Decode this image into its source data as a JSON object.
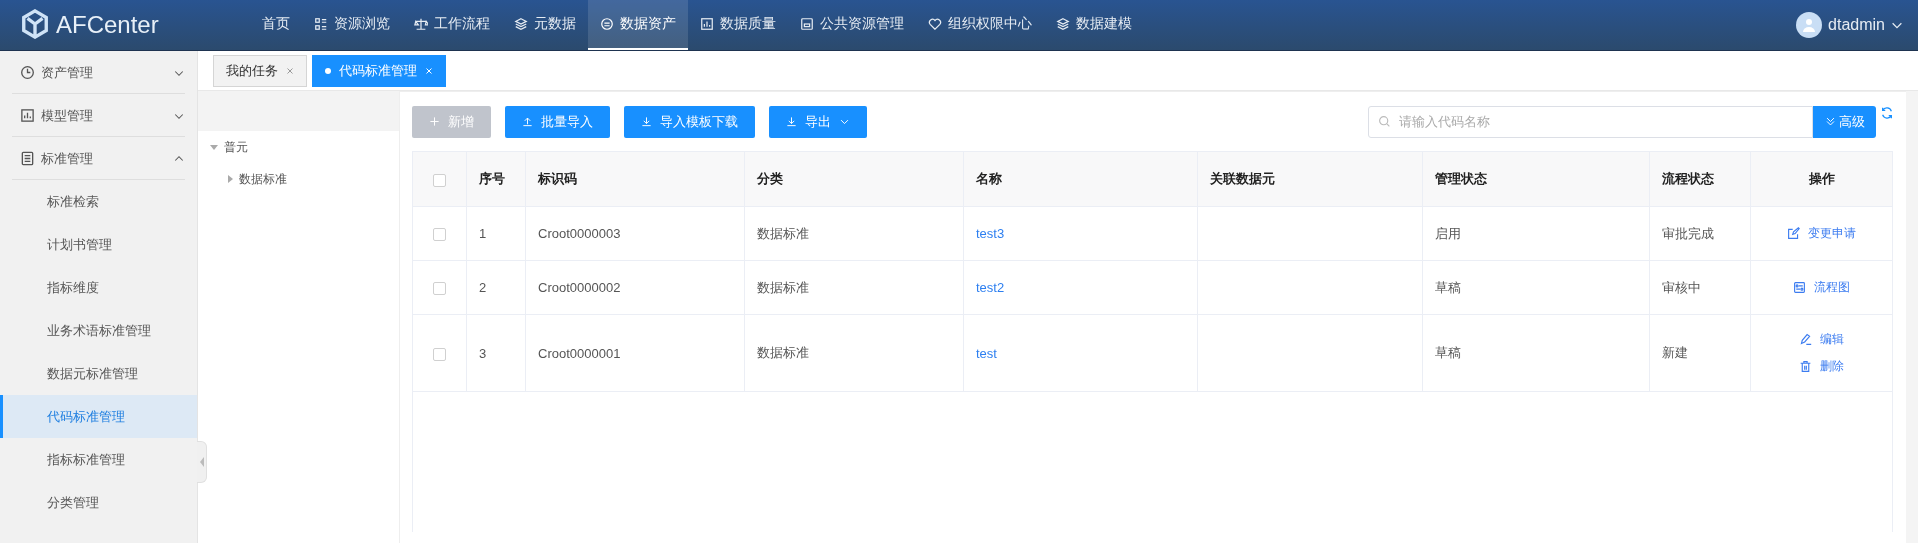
{
  "header": {
    "logo": "AFCenter",
    "nav": [
      {
        "label": "首页",
        "selected": false
      },
      {
        "label": "资源浏览",
        "selected": false
      },
      {
        "label": "工作流程",
        "selected": false
      },
      {
        "label": "元数据",
        "selected": false
      },
      {
        "label": "数据资产",
        "selected": true
      },
      {
        "label": "数据质量",
        "selected": false
      },
      {
        "label": "公共资源管理",
        "selected": false
      },
      {
        "label": "组织权限中心",
        "selected": false
      },
      {
        "label": "数据建模",
        "selected": false
      }
    ],
    "user": "dtadmin"
  },
  "sidebar": {
    "groups": [
      {
        "label": "资产管理",
        "expanded": false
      },
      {
        "label": "模型管理",
        "expanded": false
      },
      {
        "label": "标准管理",
        "expanded": true,
        "children": [
          {
            "label": "标准检索",
            "selected": false
          },
          {
            "label": "计划书管理",
            "selected": false
          },
          {
            "label": "指标维度",
            "selected": false
          },
          {
            "label": "业务术语标准管理",
            "selected": false
          },
          {
            "label": "数据元标准管理",
            "selected": false
          },
          {
            "label": "代码标准管理",
            "selected": true
          },
          {
            "label": "指标标准管理",
            "selected": false
          },
          {
            "label": "分类管理",
            "selected": false
          }
        ]
      }
    ]
  },
  "tabs": [
    {
      "label": "我的任务",
      "selected": false
    },
    {
      "label": "代码标准管理",
      "selected": true
    }
  ],
  "tree": [
    {
      "label": "普元",
      "expanded": true,
      "children": [
        {
          "label": "数据标准",
          "expanded": false
        }
      ]
    }
  ],
  "toolbar": {
    "buttons": [
      {
        "label": "新增",
        "disabled": true,
        "dropdown": false
      },
      {
        "label": "批量导入",
        "disabled": false,
        "dropdown": false
      },
      {
        "label": "导入模板下载",
        "disabled": false,
        "dropdown": false
      },
      {
        "label": "导出",
        "disabled": false,
        "dropdown": true
      }
    ],
    "search": {
      "placeholder": "请输入代码名称"
    },
    "advanced": "高级"
  },
  "table": {
    "all_checked": false,
    "columns": [
      "序号",
      "标识码",
      "分类",
      "名称",
      "关联数据元",
      "管理状态",
      "流程状态",
      "操作"
    ],
    "rows": [
      {
        "checked": false,
        "cells": [
          "1",
          "Croot0000003",
          "数据标准",
          "test3",
          "",
          "启用",
          "审批完成"
        ],
        "actions": [
          {
            "kind": "request",
            "label": "变更申请"
          }
        ]
      },
      {
        "checked": false,
        "cells": [
          "2",
          "Croot0000002",
          "数据标准",
          "test2",
          "",
          "草稿",
          "审核中"
        ],
        "actions": [
          {
            "kind": "flow",
            "label": "流程图"
          }
        ]
      },
      {
        "checked": false,
        "cells": [
          "3",
          "Croot0000001",
          "数据标准",
          "test",
          "",
          "草稿",
          "新建"
        ],
        "actions": [
          {
            "kind": "edit",
            "label": "编辑"
          },
          {
            "kind": "delete",
            "label": "删除"
          }
        ]
      }
    ]
  }
}
